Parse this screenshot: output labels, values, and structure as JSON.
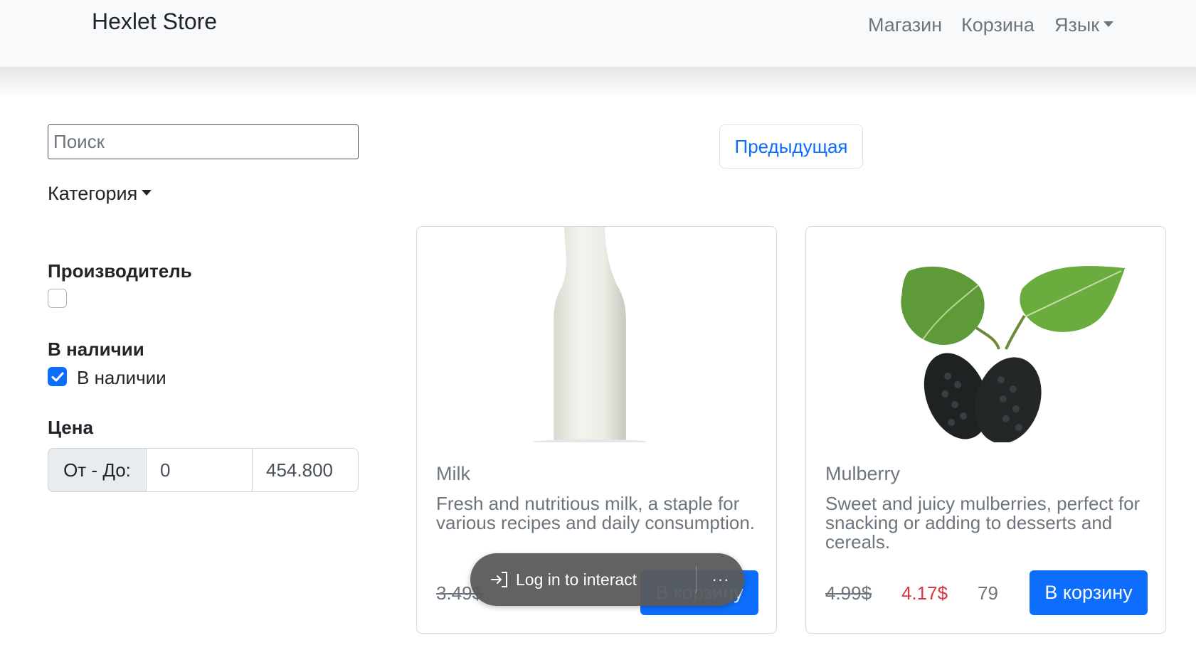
{
  "navbar": {
    "brand": "Hexlet Store",
    "links": [
      "Магазин",
      "Корзина",
      "Язык"
    ]
  },
  "sidebar": {
    "search_placeholder": "Поиск",
    "category_label": "Категория",
    "manufacturer_title": "Производитель",
    "stock_title": "В наличии",
    "stock_checkbox_label": "В наличии",
    "stock_checked": true,
    "price_title": "Цена",
    "price_addon": "От - До:",
    "price_from": "0",
    "price_to": "454.800"
  },
  "pagination": {
    "prev_label": "Предыдущая"
  },
  "products": [
    {
      "title": "Milk",
      "description": "Fresh and nutritious milk, a staple for various recipes and daily consumption.",
      "old_price": "3.49$",
      "cart_label": "В корзину"
    },
    {
      "title": "Mulberry",
      "description": "Sweet and juicy mulberries, perfect for snacking or adding to desserts and cereals.",
      "old_price": "4.99$",
      "new_price": "4.17$",
      "stock": "79",
      "cart_label": "В корзину"
    }
  ],
  "overlay": {
    "login_text": "Log in to interact",
    "more_label": "···"
  },
  "colors": {
    "primary": "#0d6efd",
    "sale_red": "#dc3545",
    "muted": "#6c757d"
  }
}
